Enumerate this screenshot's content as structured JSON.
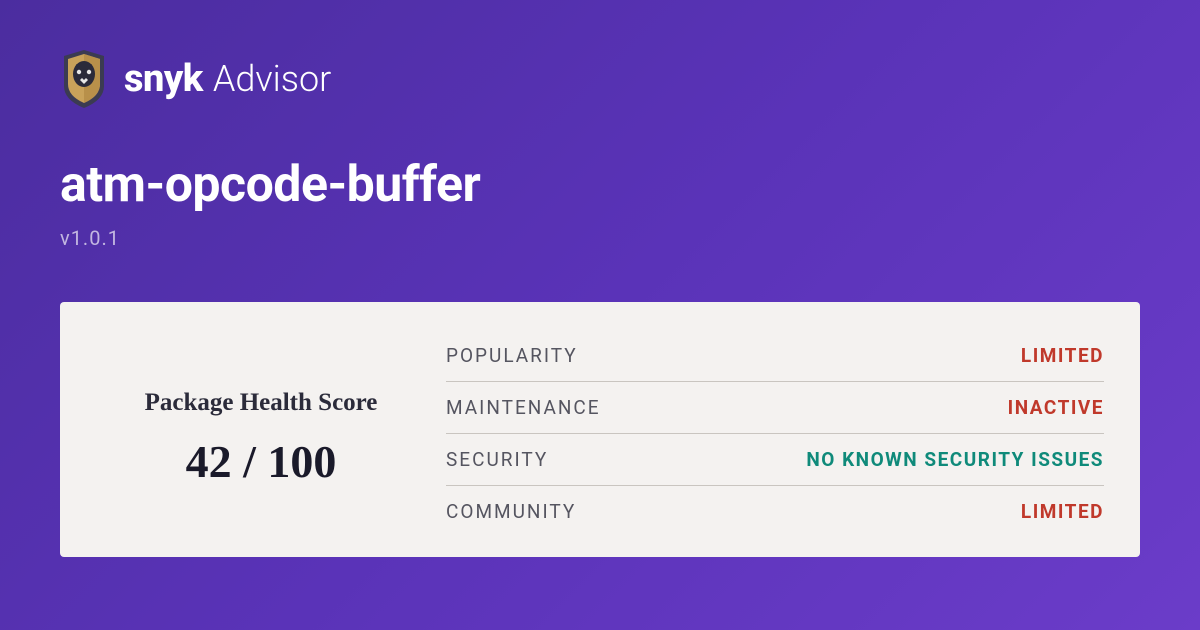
{
  "brand": {
    "name": "snyk",
    "sub": "Advisor"
  },
  "package": {
    "name": "atm-opcode-buffer",
    "version": "v1.0.1"
  },
  "score": {
    "title": "Package Health Score",
    "value": "42 / 100"
  },
  "metrics": [
    {
      "label": "POPULARITY",
      "value": "LIMITED",
      "status": "red"
    },
    {
      "label": "MAINTENANCE",
      "value": "INACTIVE",
      "status": "red"
    },
    {
      "label": "SECURITY",
      "value": "NO KNOWN SECURITY ISSUES",
      "status": "teal"
    },
    {
      "label": "COMMUNITY",
      "value": "LIMITED",
      "status": "red"
    }
  ]
}
